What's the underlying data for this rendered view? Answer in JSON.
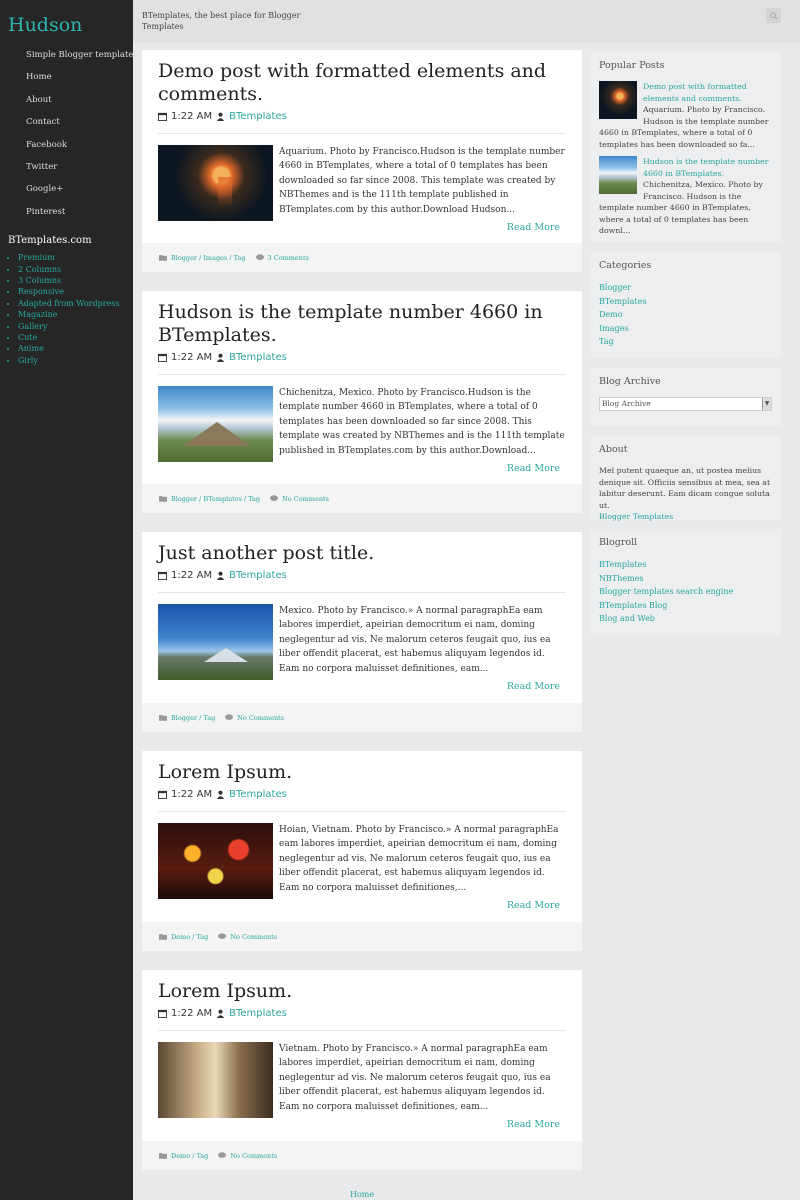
{
  "site": {
    "title": "Hudson",
    "description": "BTemplates, the best place for Blogger Templates"
  },
  "nav": [
    "Simple Blogger templates",
    "Home",
    "About",
    "Contact",
    "Facebook",
    "Twitter",
    "Google+",
    "Pinterest"
  ],
  "left_widget": {
    "title": "BTemplates.com",
    "items": [
      "Premium",
      "2 Columns",
      "3 Columns",
      "Responsive",
      "Adapted from Wordpress",
      "Magazine",
      "Gallery",
      "Cute",
      "Anime",
      "Girly"
    ]
  },
  "posts": [
    {
      "title": "Demo post with formatted elements and comments.",
      "time": "1:22 AM",
      "author": "BTemplates",
      "excerpt": "Aquarium. Photo by Francisco.Hudson is the template number 4660 in BTemplates, where a total of 0 templates has been downloaded so far since 2008. This template was created by NBThemes and is the 111th template published in BTemplates.com by this author.Download Hudson...",
      "read_more": "Read More",
      "labels": "Blogger / Images / Tag",
      "comments": "3 Comments",
      "image": "jellyfish-photo"
    },
    {
      "title": "Hudson is the template number 4660 in BTemplates.",
      "time": "1:22 AM",
      "author": "BTemplates",
      "excerpt": "Chichenitza, Mexico. Photo by Francisco.Hudson is the template number 4660 in BTemplates, where a total of 0 templates has been downloaded so far since 2008. This template was created by NBThemes and is the 111th template published in BTemplates.com by this author.Download...",
      "read_more": "Read More",
      "labels": "Blogger / BTemplates / Tag",
      "comments": "No Comments",
      "image": "pyramid-photo"
    },
    {
      "title": "Just another post title.",
      "time": "1:22 AM",
      "author": "BTemplates",
      "excerpt": "Mexico. Photo by Francisco.» A normal paragraphEa eam labores imperdiet, apeirian democritum ei nam, doming neglegentur ad vis. Ne malorum ceteros feugait quo, ius ea liber offendit placerat, est habemus aliquyam legendos id. Eam no corpora maluisset definitiones, eam...",
      "read_more": "Read More",
      "labels": "Blogger / Tag",
      "comments": "No Comments",
      "image": "volcano-photo"
    },
    {
      "title": "Lorem Ipsum.",
      "time": "1:22 AM",
      "author": "BTemplates",
      "excerpt": "Hoian, Vietnam. Photo by Francisco.» A normal paragraphEa eam labores imperdiet, apeirian democritum ei nam, doming neglegentur ad vis. Ne malorum ceteros feugait quo, ius ea liber offendit placerat, est habemus aliquyam legendos id. Eam no corpora maluisset definitiones,...",
      "read_more": "Read More",
      "labels": "Demo / Tag",
      "comments": "No Comments",
      "image": "lanterns-photo"
    },
    {
      "title": "Lorem Ipsum.",
      "time": "1:22 AM",
      "author": "BTemplates",
      "excerpt": "Vietnam. Photo by Francisco.» A normal paragraphEa eam labores imperdiet, apeirian democritum ei nam, doming neglegentur ad vis. Ne malorum ceteros feugait quo, ius ea liber offendit placerat, est habemus aliquyam legendos id. Eam no corpora maluisset definitiones, eam...",
      "read_more": "Read More",
      "labels": "Demo / Tag",
      "comments": "No Comments",
      "image": "cave-photo"
    }
  ],
  "popular": {
    "title": "Popular Posts",
    "items": [
      {
        "link": "Demo post with formatted elements and comments.",
        "text": "Aquarium. Photo by Francisco. Hudson is the template number 4660 in BTemplates, where a total of 0 templates has been downloaded so fa..."
      },
      {
        "link": "Hudson is the template number 4660 in BTemplates.",
        "text": "Chichenitza, Mexico. Photo by Francisco. Hudson is the template number 4660 in BTemplates, where a total of 0 templates has been downl..."
      }
    ]
  },
  "categories": {
    "title": "Categories",
    "items": [
      "Blogger",
      "BTemplates",
      "Demo",
      "Images",
      "Tag"
    ]
  },
  "archive": {
    "title": "Blog Archive",
    "selected": "Blog Archive"
  },
  "about": {
    "title": "About",
    "text": "Mel putent quaeque an, ut postea melius denique sit. Officiis sensibus at mea, sea at labitur deserunt. Eam dicam congue soluta ut.",
    "link": "Blogger Templates"
  },
  "blogroll": {
    "title": "Blogroll",
    "items": [
      "BTemplates",
      "NBThemes",
      "Blogger templates search engine",
      "BTemplates Blog",
      "Blog and Web"
    ]
  },
  "pager": {
    "home": "Home"
  },
  "colors": {
    "accent": "#2aa6a0",
    "sidebar_bg": "#262626",
    "page_bg": "#e8e9ea"
  }
}
